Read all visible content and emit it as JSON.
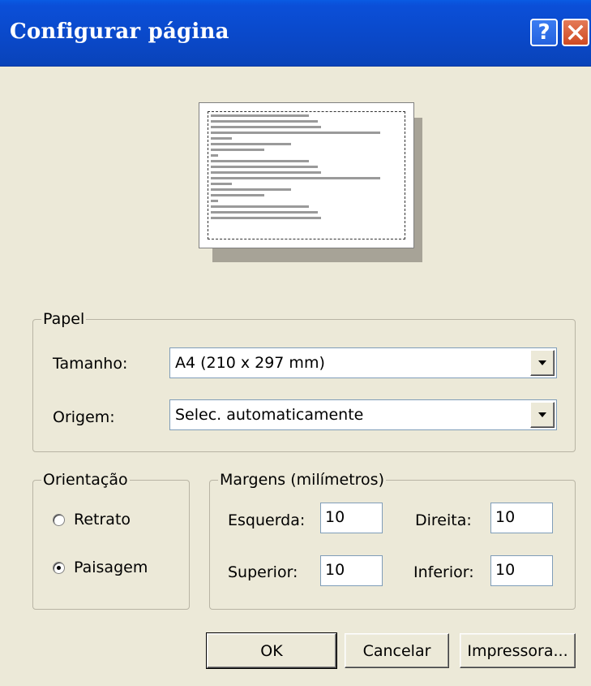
{
  "window": {
    "title": "Configurar página",
    "help_icon": "?",
    "close_icon": "close-icon"
  },
  "paper": {
    "legend": "Papel",
    "size_label": "Tamanho:",
    "size_value": "A4 (210 x 297 mm)",
    "source_label": "Origem:",
    "source_value": "Selec. automaticamente"
  },
  "orientation": {
    "legend": "Orientação",
    "options": [
      {
        "label": "Retrato",
        "checked": false
      },
      {
        "label": "Paisagem",
        "checked": true
      }
    ]
  },
  "margins": {
    "legend": "Margens (milímetros)",
    "left_label": "Esquerda:",
    "left_value": "10",
    "right_label": "Direita:",
    "right_value": "10",
    "top_label": "Superior:",
    "top_value": "10",
    "bottom_label": "Inferior:",
    "bottom_value": "10"
  },
  "buttons": {
    "ok": "OK",
    "cancel": "Cancelar",
    "printer": "Impressora..."
  }
}
